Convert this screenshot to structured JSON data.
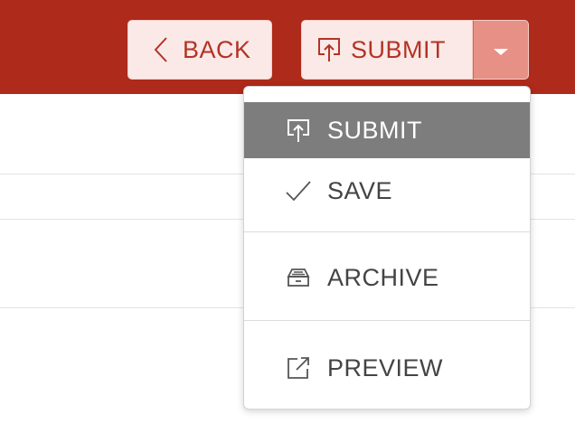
{
  "toolbar": {
    "back_label": "BACK",
    "submit_label": "SUBMIT",
    "colors": {
      "bar": "#ae2a1a",
      "button_bg": "#fbe9e7",
      "button_text": "#b23425",
      "caret_bg": "#e79086"
    },
    "icons": {
      "back": "chevron-left-icon",
      "submit": "upload-icon",
      "caret": "caret-down-icon"
    }
  },
  "menu": {
    "items": [
      {
        "label": "SUBMIT",
        "icon": "upload-icon",
        "highlighted": true
      },
      {
        "label": "SAVE",
        "icon": "checkmark-icon",
        "highlighted": false
      },
      {
        "label": "ARCHIVE",
        "icon": "archive-tray-icon",
        "highlighted": false
      },
      {
        "label": "PREVIEW",
        "icon": "external-link-icon",
        "highlighted": false
      }
    ],
    "colors": {
      "highlight_bg": "#7d7d7d",
      "text": "#444444"
    }
  }
}
